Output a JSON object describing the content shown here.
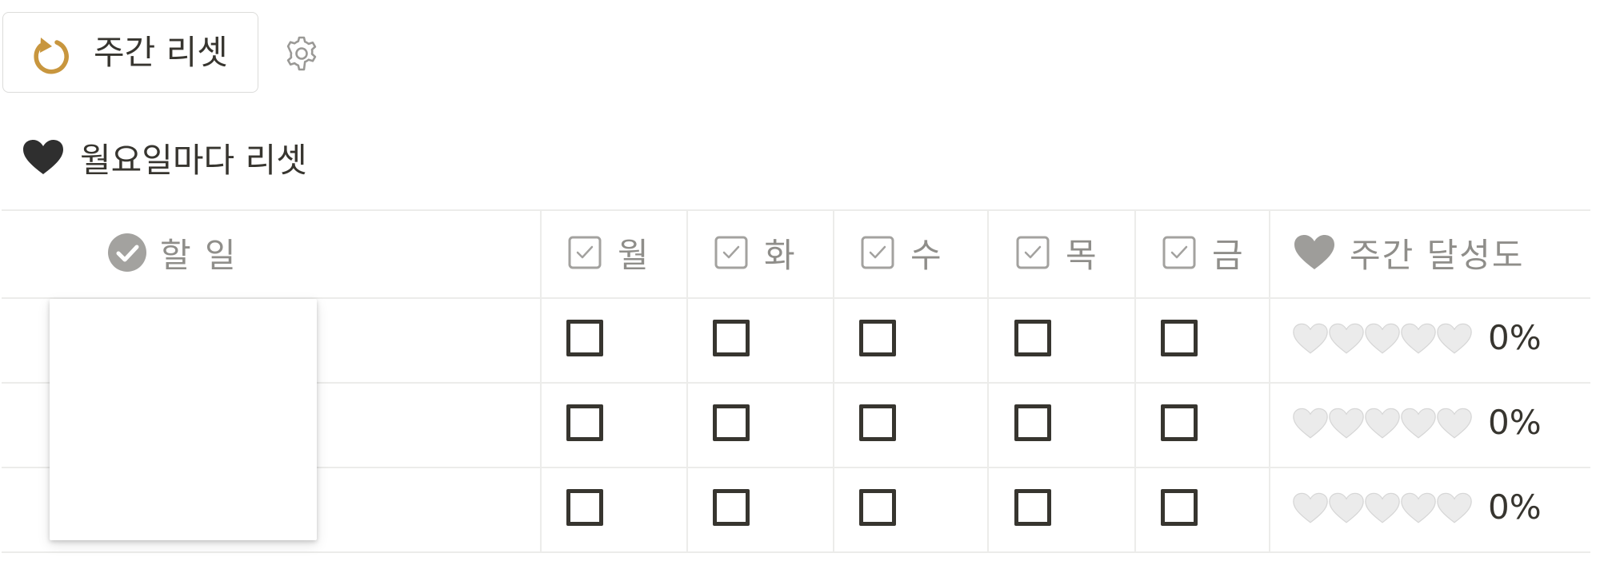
{
  "toolbar": {
    "reset_label": "주간 리셋",
    "reset_icon": "refresh-icon",
    "settings_icon": "gear-icon",
    "accent_color": "#c8963e"
  },
  "section": {
    "icon": "black-heart-icon",
    "title": "월요일마다 리셋"
  },
  "table": {
    "columns": [
      {
        "label": "할 일",
        "icon": "check-circle-icon"
      },
      {
        "label": "월",
        "icon": "checkbox-icon"
      },
      {
        "label": "화",
        "icon": "checkbox-icon"
      },
      {
        "label": "수",
        "icon": "checkbox-icon"
      },
      {
        "label": "목",
        "icon": "checkbox-icon"
      },
      {
        "label": "금",
        "icon": "checkbox-icon"
      },
      {
        "label": "주간 달성도",
        "icon": "grey-heart-icon"
      }
    ],
    "rows": [
      {
        "task": "",
        "days": [
          false,
          false,
          false,
          false,
          false
        ],
        "hearts": "🤍🤍🤍🤍🤍",
        "percent": "0%"
      },
      {
        "task": "",
        "days": [
          false,
          false,
          false,
          false,
          false
        ],
        "hearts": "🤍🤍🤍🤍🤍",
        "percent": "0%"
      },
      {
        "task": "",
        "days": [
          false,
          false,
          false,
          false,
          false
        ],
        "hearts": "🤍🤍🤍🤍🤍",
        "percent": "0%"
      }
    ]
  }
}
